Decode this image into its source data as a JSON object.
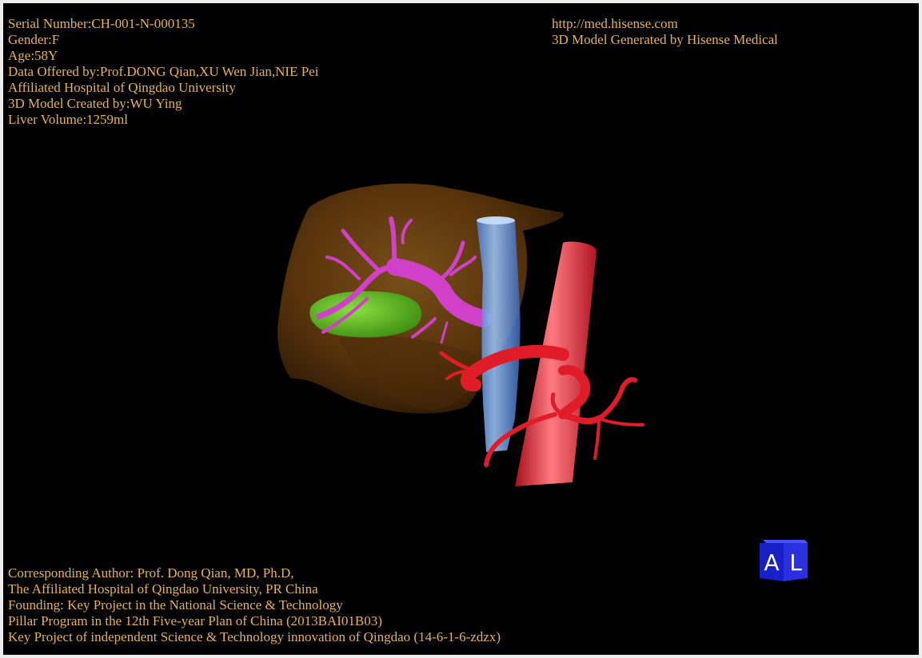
{
  "patient_info": {
    "serial_number": "Serial Number:CH-001-N-000135",
    "gender": "Gender:F",
    "age": "Age:58Y",
    "data_offered_by": "Data Offered by:Prof.DONG Qian,XU Wen Jian,NIE Pei",
    "hospital": "Affiliated Hospital of Qingdao University",
    "model_created_by": "3D Model Created by:WU Ying",
    "liver_volume": "Liver Volume:1259ml"
  },
  "branding": {
    "url": "http://med.hisense.com",
    "generator": "3D Model Generated by Hisense Medical"
  },
  "credits": {
    "line1": "Corresponding Author: Prof. Dong Qian, MD, Ph.D,",
    "line2": "The Affiliated Hospital of Qingdao University, PR China",
    "line3": "Founding: Key Project in the National Science & Technology",
    "line4": "Pillar Program in the 12th Five-year Plan of China (2013BAI01B03)",
    "line5": "Key Project of independent Science & Technology innovation of Qingdao (14-6-1-6-zdzx)"
  },
  "orientation_cube": {
    "face_left": "A",
    "face_right": "L",
    "color": "#1a22d8"
  },
  "colors": {
    "text": "#e8b448",
    "background": "#000000",
    "liver": "#7a4a14",
    "gallbladder": "#5fc020",
    "portal_vein": "#d040c8",
    "vena_cava": "#6ea4ec",
    "artery": "#e01c28"
  }
}
